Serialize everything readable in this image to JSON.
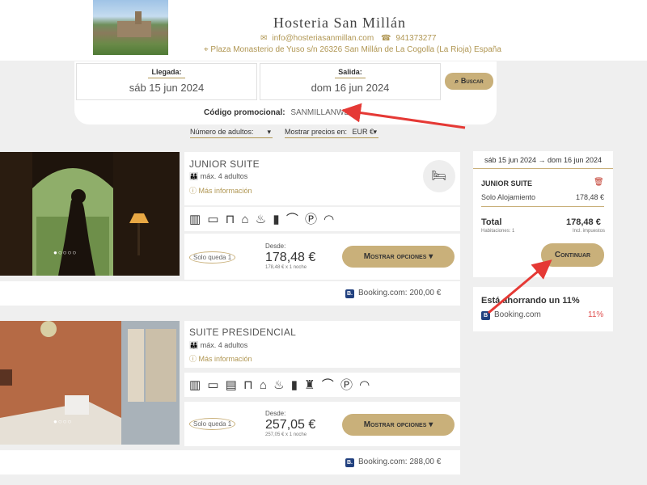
{
  "header": {
    "hotel_name": "Hosteria San Millán",
    "email": "info@hosteriasanmillan.com",
    "phone": "941373277",
    "address": "Plaza Monasterio de Yuso s/n 26326 San Millán de La Cogolla (La Rioja) España"
  },
  "search": {
    "checkin_label": "Llegada:",
    "checkin_value": "sáb 15 jun 2024",
    "checkout_label": "Salida:",
    "checkout_value": "dom 16 jun 2024",
    "search_button": "Buscar",
    "promo_label": "Código promocional:",
    "promo_code": "SANMILLANWEB"
  },
  "filters": {
    "adults": "Número de adultos:",
    "currency_label": "Mostrar precios en:",
    "currency_value": "EUR €"
  },
  "rooms": [
    {
      "name": "JUNIOR SUITE",
      "capacity": "máx. 4 adultos",
      "more_info": "Más información",
      "availability": "Solo queda 1",
      "from_label": "Desde:",
      "price": "178,48 €",
      "price_sub": "178,48 € x 1 noche",
      "options_button": "Mostrar opciones",
      "booking_text": "Booking.com: 200,00 €"
    },
    {
      "name": "SUITE PRESIDENCIAL",
      "capacity": "máx. 4 adultos",
      "more_info": "Más información",
      "availability": "Solo queda 1",
      "from_label": "Desde:",
      "price": "257,05 €",
      "price_sub": "257,05 € x 1 noche",
      "options_button": "Mostrar opciones",
      "booking_text": "Booking.com: 288,00 €"
    }
  ],
  "cart": {
    "dates": "sáb 15 jun 2024 → dom 16 jun 2024",
    "room_name": "JUNIOR SUITE",
    "rate_name": "Solo Alojamiento",
    "rate_price": "178,48 €",
    "total_label": "Total",
    "total_value": "178,48 €",
    "rooms_count": "Habitaciones: 1",
    "taxes_note": "Incl. impuestos",
    "continue_button": "Continuar"
  },
  "savings": {
    "title": "Está ahorrando un 11%",
    "booking": "Booking.com",
    "percent": "11%"
  },
  "colors": {
    "accent": "#c9b07a",
    "arrow": "#e53935"
  }
}
